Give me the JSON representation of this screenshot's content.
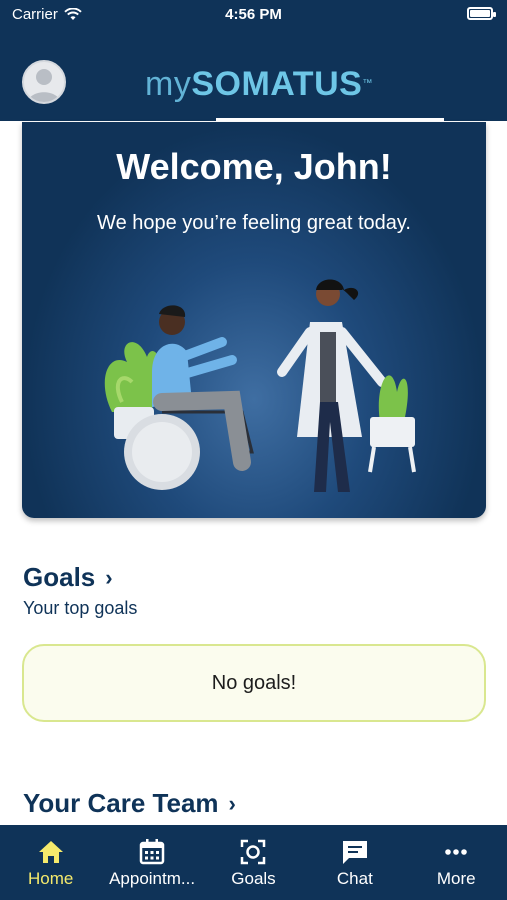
{
  "status_bar": {
    "carrier": "Carrier",
    "time": "4:56 PM",
    "battery_level_percent": 100
  },
  "header": {
    "logo_my": "my",
    "logo_brand": "SOMATUS",
    "logo_tm": "™"
  },
  "welcome": {
    "title": "Welcome, John!",
    "subtitle": "We hope you’re feeling great today."
  },
  "goals": {
    "title": "Goals",
    "subtitle": "Your top goals",
    "empty_text": "No goals!"
  },
  "care_team": {
    "title": "Your Care Team"
  },
  "tabs": [
    {
      "label": "Home",
      "icon": "home-icon",
      "active": true
    },
    {
      "label": "Appointm...",
      "icon": "calendar-icon",
      "active": false
    },
    {
      "label": "Goals",
      "icon": "goals-scan-icon",
      "active": false
    },
    {
      "label": "Chat",
      "icon": "chat-icon",
      "active": false
    },
    {
      "label": "More",
      "icon": "more-icon",
      "active": false
    }
  ],
  "colors": {
    "navy": "#0f3358",
    "accent_yellow": "#f5ea6c",
    "goals_border": "#d9e78f",
    "logo_blue": "#6ec6e6"
  }
}
